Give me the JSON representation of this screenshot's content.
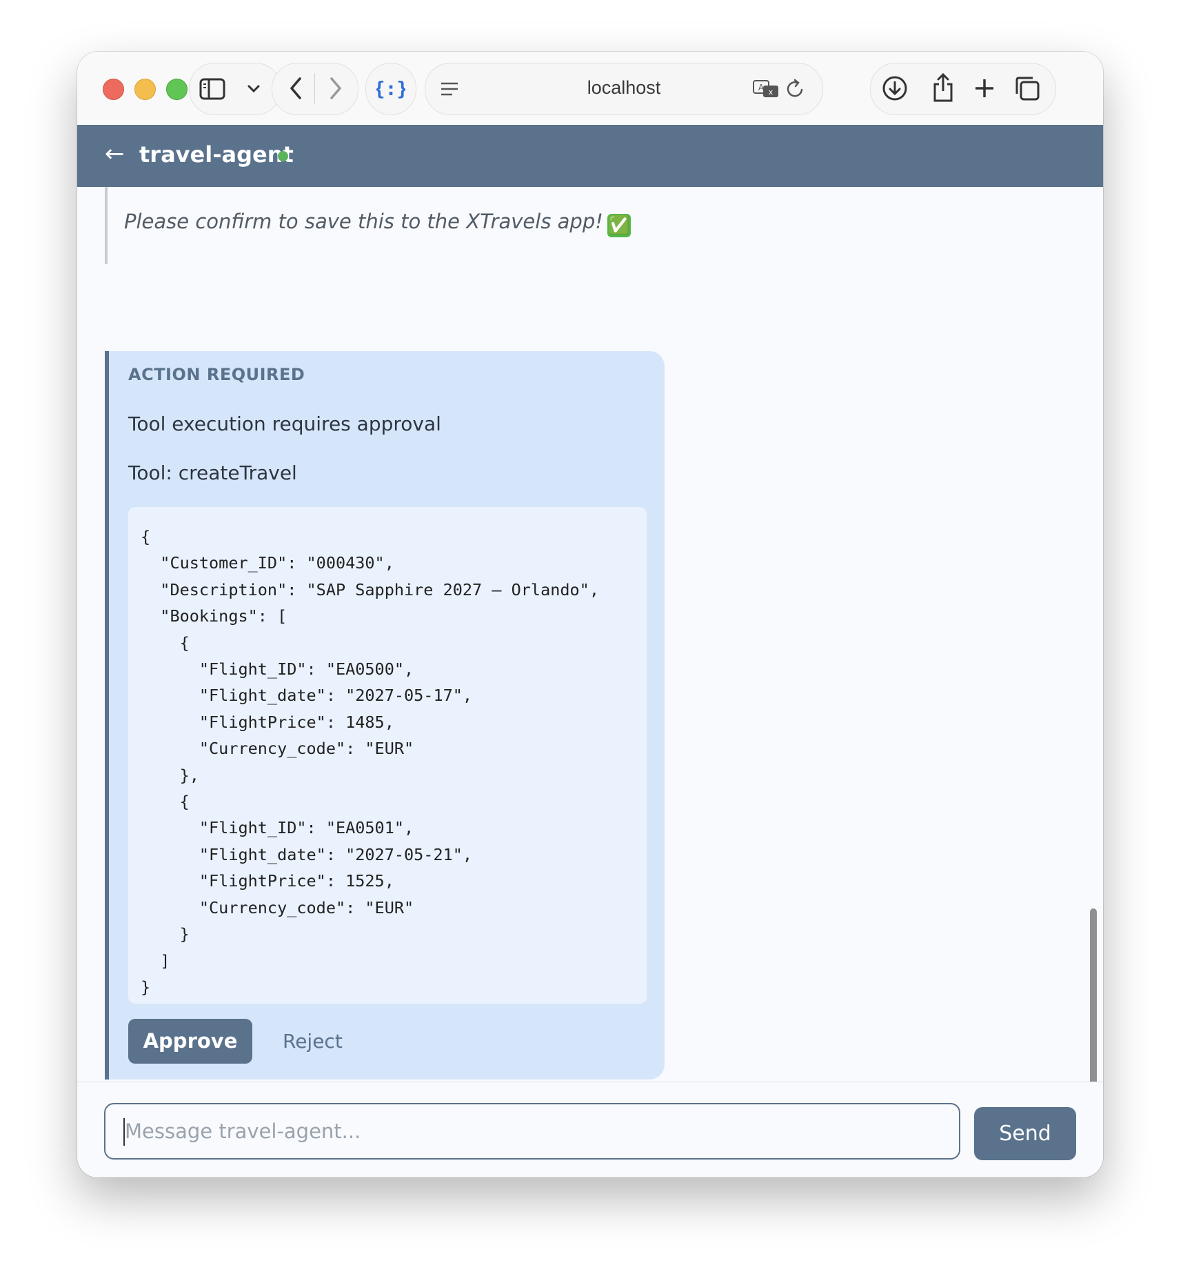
{
  "browser": {
    "url": "localhost",
    "icons": {
      "sidebar": "sidebar-icon",
      "chevron": "chevron-down-icon",
      "back": "back-icon",
      "forward": "forward-icon",
      "extension": "extension-icon",
      "reader": "reader-icon",
      "translate": "translate-icon",
      "reload": "reload-icon",
      "download": "download-icon",
      "share": "share-icon",
      "new_tab": "plus-icon",
      "tabs": "tab-overview-icon"
    }
  },
  "app": {
    "back_arrow": "←",
    "title": "travel-agent",
    "status_color": "#5bb35b",
    "accent_color": "#5a728c"
  },
  "chat": {
    "previous_message_tail": "Please confirm to save this to the XTravels app!",
    "previous_message_emoji": "✅",
    "action": {
      "label": "ACTION REQUIRED",
      "message": "Tool execution requires approval",
      "tool_line": "Tool: createTravel",
      "code": "{\n  \"Customer_ID\": \"000430\",\n  \"Description\": \"SAP Sapphire 2027 – Orlando\",\n  \"Bookings\": [\n    {\n      \"Flight_ID\": \"EA0500\",\n      \"Flight_date\": \"2027-05-17\",\n      \"FlightPrice\": 1485,\n      \"Currency_code\": \"EUR\"\n    },\n    {\n      \"Flight_ID\": \"EA0501\",\n      \"Flight_date\": \"2027-05-21\",\n      \"FlightPrice\": 1525,\n      \"Currency_code\": \"EUR\"\n    }\n  ]\n}",
      "approve_label": "Approve",
      "reject_label": "Reject"
    }
  },
  "composer": {
    "placeholder": "Message travel-agent...",
    "send_label": "Send"
  }
}
